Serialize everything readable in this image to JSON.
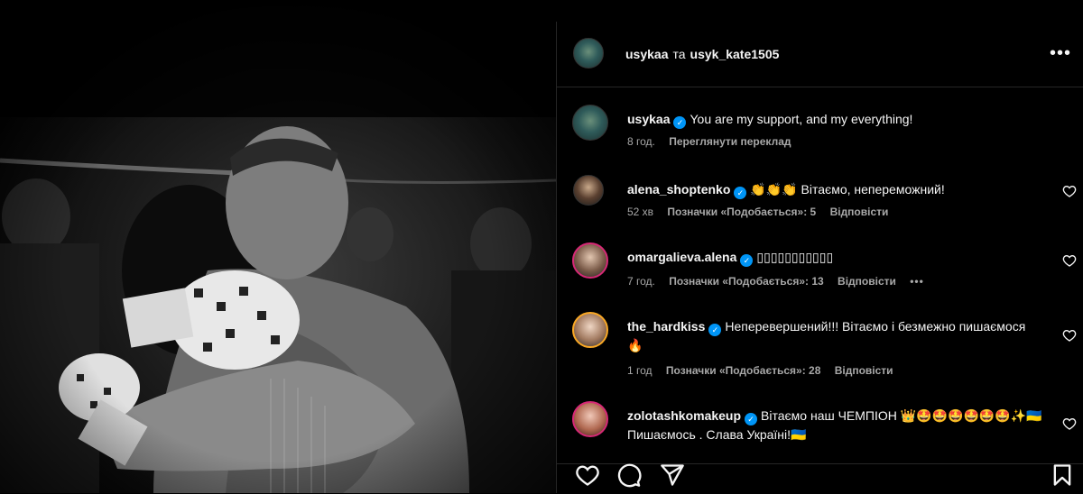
{
  "header": {
    "user1": "usykaa",
    "separator": "та",
    "user2": "usyk_kate1505",
    "more_icon": "more-horizontal-icon"
  },
  "caption": {
    "username": "usykaa",
    "text": "You are my support, and my everything!",
    "time": "8 год.",
    "translate": "Переглянути переклад"
  },
  "comments": [
    {
      "username": "alena_shoptenko",
      "text": "👏👏👏 Вітаємо, непереможний!",
      "time": "52 хв",
      "likes": "Позначки «Подобається»: 5",
      "reply": "Відповісти"
    },
    {
      "username": "omargalieva.alena",
      "text": "▯▯▯▯▯▯▯▯▯▯▯",
      "time": "7 год.",
      "likes": "Позначки «Подобається»: 13",
      "reply": "Відповісти",
      "more": "•••"
    },
    {
      "username": "the_hardkiss",
      "text": "Неперевершений!!! Вітаємо і безмежно пишаємося 🔥",
      "time": "1 год",
      "likes": "Позначки «Подобається»: 28",
      "reply": "Відповісти"
    },
    {
      "username": "zolotashkomakeup",
      "text": "Вітаємо наш ЧЕМПІОН 👑🤩🤩🤩🤩🤩🤩✨🇺🇦 Пишаємось . Слава Україні!🇺🇦"
    }
  ],
  "icons": {
    "like": "heart-icon",
    "comment": "comment-icon",
    "share": "send-icon",
    "save": "bookmark-icon"
  },
  "colors": {
    "verified": "#0095f6",
    "meta_text": "#a8a8a8",
    "divider": "#262626"
  }
}
